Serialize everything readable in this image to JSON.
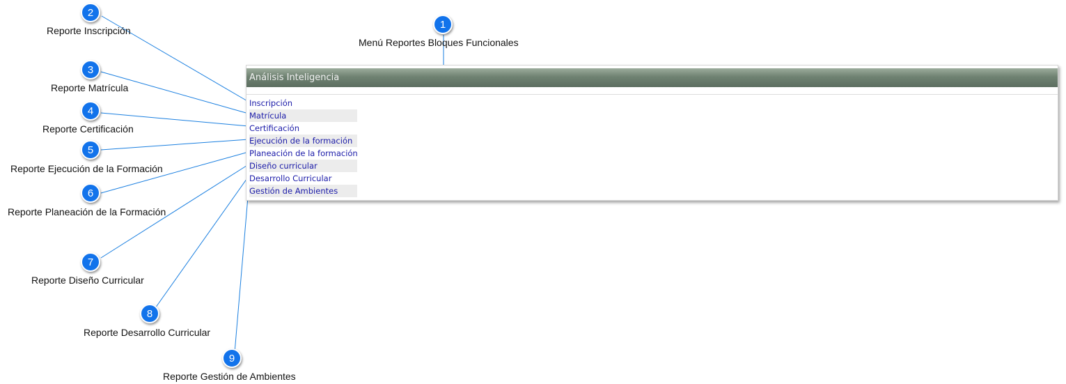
{
  "panel": {
    "title": "Análisis Inteligencia",
    "items": [
      {
        "label": "Inscripción"
      },
      {
        "label": "Matrícula"
      },
      {
        "label": "Certificación"
      },
      {
        "label": "Ejecución de la formación"
      },
      {
        "label": "Planeación de la formación"
      },
      {
        "label": "Diseño curricular"
      },
      {
        "label": "Desarrollo Curricular"
      },
      {
        "label": "Gestión de Ambientes"
      }
    ]
  },
  "callouts": [
    {
      "number": "1",
      "label": "Menú Reportes Bloques Funcionales"
    },
    {
      "number": "2",
      "label": "Reporte Inscripción"
    },
    {
      "number": "3",
      "label": "Reporte Matrícula"
    },
    {
      "number": "4",
      "label": "Reporte Certificación"
    },
    {
      "number": "5",
      "label": "Reporte Ejecución de la Formación"
    },
    {
      "number": "6",
      "label": "Reporte Planeación de la Formación"
    },
    {
      "number": "7",
      "label": "Reporte Diseño Curricular"
    },
    {
      "number": "8",
      "label": "Reporte Desarrollo Curricular"
    },
    {
      "number": "9",
      "label": "Reporte Gestión de Ambientes"
    }
  ],
  "colors": {
    "badge": "#1273eb",
    "connector": "#1a7fe0",
    "link": "#1a1aa8",
    "header": "#6f8272"
  }
}
